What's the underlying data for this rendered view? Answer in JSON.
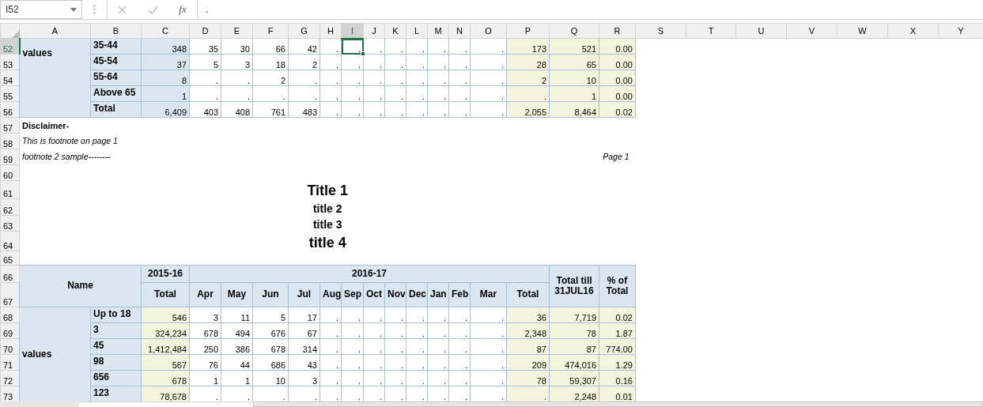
{
  "name_box": {
    "text": "I52"
  },
  "formula_bar": {
    "function_label": "fx",
    "value": "."
  },
  "columns": [
    "A",
    "B",
    "C",
    "D",
    "E",
    "F",
    "G",
    "H",
    "I",
    "J",
    "K",
    "L",
    "M",
    "N",
    "O",
    "P",
    "Q",
    "R",
    "S",
    "T",
    "U",
    "V",
    "W",
    "X",
    "Y"
  ],
  "rows": [
    {
      "number": "52",
      "cells": [
        {
          "text": "values",
          "kind": "group",
          "selected": false
        },
        {
          "text": "35-44",
          "kind": "label",
          "selected": false
        },
        {
          "text": "348",
          "kind": "bnum",
          "selected": false
        },
        {
          "text": "35",
          "kind": "num",
          "selected": false
        },
        {
          "text": "30",
          "kind": "num",
          "selected": false
        },
        {
          "text": "66",
          "kind": "num",
          "selected": false
        },
        {
          "text": "42",
          "kind": "num",
          "selected": false
        },
        {
          "text": ".",
          "kind": "num",
          "selected": false
        },
        {
          "text": ".",
          "kind": "num",
          "selected": true
        },
        {
          "text": ".",
          "kind": "num",
          "selected": false
        },
        {
          "text": ".",
          "kind": "num",
          "selected": false
        },
        {
          "text": ".",
          "kind": "num",
          "selected": false
        },
        {
          "text": ".",
          "kind": "num",
          "selected": false
        },
        {
          "text": ".",
          "kind": "num",
          "selected": false
        },
        {
          "text": ".",
          "kind": "num",
          "selected": false
        },
        {
          "text": "173",
          "kind": "sum",
          "selected": false
        },
        {
          "text": "521",
          "kind": "sum",
          "selected": false
        },
        {
          "text": "0.00",
          "kind": "sum",
          "selected": false
        }
      ]
    },
    {
      "number": "53",
      "cells": [
        {
          "text": "45-54",
          "kind": "label",
          "selected": false
        },
        {
          "text": "37",
          "kind": "bnum",
          "selected": false
        },
        {
          "text": "5",
          "kind": "num",
          "selected": false
        },
        {
          "text": "3",
          "kind": "num",
          "selected": false
        },
        {
          "text": "18",
          "kind": "num",
          "selected": false
        },
        {
          "text": "2",
          "kind": "num",
          "selected": false
        },
        {
          "text": ".",
          "kind": "num",
          "selected": false
        },
        {
          "text": ".",
          "kind": "num",
          "selected": false
        },
        {
          "text": ".",
          "kind": "num",
          "selected": false
        },
        {
          "text": ".",
          "kind": "num",
          "selected": false
        },
        {
          "text": ".",
          "kind": "num",
          "selected": false
        },
        {
          "text": ".",
          "kind": "num",
          "selected": false
        },
        {
          "text": ".",
          "kind": "num",
          "selected": false
        },
        {
          "text": ".",
          "kind": "num",
          "selected": false
        },
        {
          "text": "28",
          "kind": "sum",
          "selected": false
        },
        {
          "text": "65",
          "kind": "sum",
          "selected": false
        },
        {
          "text": "0.00",
          "kind": "sum",
          "selected": false
        }
      ]
    },
    {
      "number": "54",
      "cells": [
        {
          "text": "55-64",
          "kind": "label",
          "selected": false
        },
        {
          "text": "8",
          "kind": "bnum",
          "selected": false
        },
        {
          "text": ".",
          "kind": "num",
          "selected": false
        },
        {
          "text": ".",
          "kind": "num",
          "selected": false
        },
        {
          "text": "2",
          "kind": "num",
          "selected": false
        },
        {
          "text": ".",
          "kind": "num",
          "selected": false
        },
        {
          "text": ".",
          "kind": "num",
          "selected": false
        },
        {
          "text": ".",
          "kind": "num",
          "selected": false
        },
        {
          "text": ".",
          "kind": "num",
          "selected": false
        },
        {
          "text": ".",
          "kind": "num",
          "selected": false
        },
        {
          "text": ".",
          "kind": "num",
          "selected": false
        },
        {
          "text": ".",
          "kind": "num",
          "selected": false
        },
        {
          "text": ".",
          "kind": "num",
          "selected": false
        },
        {
          "text": ".",
          "kind": "num",
          "selected": false
        },
        {
          "text": "2",
          "kind": "sum",
          "selected": false
        },
        {
          "text": "10",
          "kind": "sum",
          "selected": false
        },
        {
          "text": "0.00",
          "kind": "sum",
          "selected": false
        }
      ]
    },
    {
      "number": "55",
      "cells": [
        {
          "text": "Above 65",
          "kind": "label",
          "selected": false
        },
        {
          "text": "1",
          "kind": "bnum",
          "selected": false
        },
        {
          "text": ".",
          "kind": "num",
          "selected": false
        },
        {
          "text": ".",
          "kind": "num",
          "selected": false
        },
        {
          "text": ".",
          "kind": "num",
          "selected": false
        },
        {
          "text": ".",
          "kind": "num",
          "selected": false
        },
        {
          "text": ".",
          "kind": "num",
          "selected": false
        },
        {
          "text": ".",
          "kind": "num",
          "selected": false
        },
        {
          "text": ".",
          "kind": "num",
          "selected": false
        },
        {
          "text": ".",
          "kind": "num",
          "selected": false
        },
        {
          "text": ".",
          "kind": "num",
          "selected": false
        },
        {
          "text": ".",
          "kind": "num",
          "selected": false
        },
        {
          "text": ".",
          "kind": "num",
          "selected": false
        },
        {
          "text": ".",
          "kind": "num",
          "selected": false
        },
        {
          "text": ".",
          "kind": "sum",
          "selected": false
        },
        {
          "text": "1",
          "kind": "sum",
          "selected": false
        },
        {
          "text": "0.00",
          "kind": "sum",
          "selected": false
        }
      ]
    },
    {
      "number": "56",
      "cells": [
        {
          "text": "Total",
          "kind": "label",
          "selected": false
        },
        {
          "text": "6,409",
          "kind": "bnum",
          "selected": false
        },
        {
          "text": "403",
          "kind": "num",
          "selected": false
        },
        {
          "text": "408",
          "kind": "num",
          "selected": false
        },
        {
          "text": "761",
          "kind": "num",
          "selected": false
        },
        {
          "text": "483",
          "kind": "num",
          "selected": false
        },
        {
          "text": ".",
          "kind": "num",
          "selected": false
        },
        {
          "text": ".",
          "kind": "num",
          "selected": false
        },
        {
          "text": ".",
          "kind": "num",
          "selected": false
        },
        {
          "text": ".",
          "kind": "num",
          "selected": false
        },
        {
          "text": ".",
          "kind": "num",
          "selected": false
        },
        {
          "text": ".",
          "kind": "num",
          "selected": false
        },
        {
          "text": ".",
          "kind": "num",
          "selected": false
        },
        {
          "text": ".",
          "kind": "num",
          "selected": false
        },
        {
          "text": "2,055",
          "kind": "sum",
          "selected": false
        },
        {
          "text": "8,464",
          "kind": "sum",
          "selected": false
        },
        {
          "text": "0.02",
          "kind": "sum",
          "selected": false
        }
      ]
    },
    {
      "number": "57",
      "cells": [
        {
          "text": "Disclaimer-",
          "kind": "note-bold",
          "selected": false
        }
      ]
    },
    {
      "number": "58",
      "cells": [
        {
          "text": "This is footnote on page 1",
          "kind": "note",
          "selected": false
        }
      ]
    },
    {
      "number": "59",
      "cells": [
        {
          "text": "footnote 2 sample--------",
          "kind": "note",
          "selected": false
        },
        null,
        null,
        null,
        null,
        null,
        null,
        null,
        null,
        null,
        null,
        null,
        null,
        null,
        null,
        null,
        null,
        {
          "text": "Page 1",
          "kind": "note-right",
          "selected": false
        }
      ]
    },
    {
      "number": "60",
      "cells": []
    },
    {
      "number": "61",
      "cells": [
        {
          "text": "Title 1",
          "kind": "title-lg",
          "selected": false
        }
      ]
    },
    {
      "number": "62",
      "cells": [
        {
          "text": "title 2",
          "kind": "title-sm",
          "selected": false
        }
      ]
    },
    {
      "number": "63",
      "cells": [
        {
          "text": "title 3",
          "kind": "title-sm",
          "selected": false
        }
      ]
    },
    {
      "number": "64",
      "cells": [
        {
          "text": "title 4",
          "kind": "title-lg",
          "selected": false
        }
      ]
    },
    {
      "number": "65",
      "cells": []
    },
    {
      "number": "66",
      "cells": [
        {
          "text": "Name",
          "kind": "head",
          "selected": false
        },
        {
          "text": "2015-16",
          "kind": "head",
          "selected": false
        },
        {
          "text": "2016-17",
          "kind": "head",
          "selected": false
        },
        {
          "text": "Total till 31JUL16",
          "kind": "head",
          "selected": false
        },
        {
          "text": "% of Total",
          "kind": "head",
          "selected": false
        }
      ]
    },
    {
      "number": "67",
      "cells": [
        {
          "text": "Total",
          "kind": "head",
          "selected": false
        },
        {
          "text": "Apr",
          "kind": "head",
          "selected": false
        },
        {
          "text": "May",
          "kind": "head",
          "selected": false
        },
        {
          "text": "Jun",
          "kind": "head",
          "selected": false
        },
        {
          "text": "Jul",
          "kind": "head",
          "selected": false
        },
        {
          "text": "Aug",
          "kind": "head",
          "selected": false
        },
        {
          "text": "Sep",
          "kind": "head",
          "selected": false
        },
        {
          "text": "Oct",
          "kind": "head",
          "selected": false
        },
        {
          "text": "Nov",
          "kind": "head",
          "selected": false
        },
        {
          "text": "Dec",
          "kind": "head",
          "selected": false
        },
        {
          "text": "Jan",
          "kind": "head",
          "selected": false
        },
        {
          "text": "Feb",
          "kind": "head",
          "selected": false
        },
        {
          "text": "Mar",
          "kind": "head",
          "selected": false
        },
        {
          "text": "Total",
          "kind": "head",
          "selected": false
        }
      ]
    },
    {
      "number": "68",
      "cells": [
        {
          "text": "values",
          "kind": "group",
          "selected": false
        },
        {
          "text": "Up to 18",
          "kind": "label",
          "selected": false
        },
        {
          "text": "546",
          "kind": "sum",
          "selected": false
        },
        {
          "text": "3",
          "kind": "num",
          "selected": false
        },
        {
          "text": "11",
          "kind": "num",
          "selected": false
        },
        {
          "text": "5",
          "kind": "num",
          "selected": false
        },
        {
          "text": "17",
          "kind": "num",
          "selected": false
        },
        {
          "text": ".",
          "kind": "num",
          "selected": false
        },
        {
          "text": ".",
          "kind": "num",
          "selected": false
        },
        {
          "text": ".",
          "kind": "num",
          "selected": false
        },
        {
          "text": ".",
          "kind": "num",
          "selected": false
        },
        {
          "text": ".",
          "kind": "num",
          "selected": false
        },
        {
          "text": ".",
          "kind": "num",
          "selected": false
        },
        {
          "text": ".",
          "kind": "num",
          "selected": false
        },
        {
          "text": ".",
          "kind": "num",
          "selected": false
        },
        {
          "text": "36",
          "kind": "sum",
          "selected": false
        },
        {
          "text": "7,719",
          "kind": "sum",
          "selected": false
        },
        {
          "text": "0.02",
          "kind": "sum",
          "selected": false
        }
      ]
    },
    {
      "number": "69",
      "cells": [
        {
          "text": "3",
          "kind": "label",
          "selected": false
        },
        {
          "text": "324,234",
          "kind": "sum",
          "selected": false
        },
        {
          "text": "678",
          "kind": "num",
          "selected": false
        },
        {
          "text": "494",
          "kind": "num",
          "selected": false
        },
        {
          "text": "676",
          "kind": "num",
          "selected": false
        },
        {
          "text": "67",
          "kind": "num",
          "selected": false
        },
        {
          "text": ".",
          "kind": "num",
          "selected": false
        },
        {
          "text": ".",
          "kind": "num",
          "selected": false
        },
        {
          "text": ".",
          "kind": "num",
          "selected": false
        },
        {
          "text": ".",
          "kind": "num",
          "selected": false
        },
        {
          "text": ".",
          "kind": "num",
          "selected": false
        },
        {
          "text": ".",
          "kind": "num",
          "selected": false
        },
        {
          "text": ".",
          "kind": "num",
          "selected": false
        },
        {
          "text": ".",
          "kind": "num",
          "selected": false
        },
        {
          "text": "2,348",
          "kind": "sum",
          "selected": false
        },
        {
          "text": "78",
          "kind": "sum",
          "selected": false
        },
        {
          "text": "1.87",
          "kind": "sum",
          "selected": false
        }
      ]
    },
    {
      "number": "70",
      "cells": [
        {
          "text": "45",
          "kind": "label",
          "selected": false
        },
        {
          "text": "1,412,484",
          "kind": "sum",
          "selected": false
        },
        {
          "text": "250",
          "kind": "num",
          "selected": false
        },
        {
          "text": "386",
          "kind": "num",
          "selected": false
        },
        {
          "text": "678",
          "kind": "num",
          "selected": false
        },
        {
          "text": "314",
          "kind": "num",
          "selected": false
        },
        {
          "text": ".",
          "kind": "num",
          "selected": false
        },
        {
          "text": ".",
          "kind": "num",
          "selected": false
        },
        {
          "text": ".",
          "kind": "num",
          "selected": false
        },
        {
          "text": ".",
          "kind": "num",
          "selected": false
        },
        {
          "text": ".",
          "kind": "num",
          "selected": false
        },
        {
          "text": ".",
          "kind": "num",
          "selected": false
        },
        {
          "text": ".",
          "kind": "num",
          "selected": false
        },
        {
          "text": ".",
          "kind": "num",
          "selected": false
        },
        {
          "text": "87",
          "kind": "sum",
          "selected": false
        },
        {
          "text": "87",
          "kind": "sum",
          "selected": false
        },
        {
          "text": "774.00",
          "kind": "sum",
          "selected": false
        }
      ]
    },
    {
      "number": "71",
      "cells": [
        {
          "text": "98",
          "kind": "label",
          "selected": false
        },
        {
          "text": "567",
          "kind": "sum",
          "selected": false
        },
        {
          "text": "76",
          "kind": "num",
          "selected": false
        },
        {
          "text": "44",
          "kind": "num",
          "selected": false
        },
        {
          "text": "686",
          "kind": "num",
          "selected": false
        },
        {
          "text": "43",
          "kind": "num",
          "selected": false
        },
        {
          "text": ".",
          "kind": "num",
          "selected": false
        },
        {
          "text": ".",
          "kind": "num",
          "selected": false
        },
        {
          "text": ".",
          "kind": "num",
          "selected": false
        },
        {
          "text": ".",
          "kind": "num",
          "selected": false
        },
        {
          "text": ".",
          "kind": "num",
          "selected": false
        },
        {
          "text": ".",
          "kind": "num",
          "selected": false
        },
        {
          "text": ".",
          "kind": "num",
          "selected": false
        },
        {
          "text": ".",
          "kind": "num",
          "selected": false
        },
        {
          "text": "209",
          "kind": "sum",
          "selected": false
        },
        {
          "text": "474,016",
          "kind": "sum",
          "selected": false
        },
        {
          "text": "1.29",
          "kind": "sum",
          "selected": false
        }
      ]
    },
    {
      "number": "72",
      "cells": [
        {
          "text": "656",
          "kind": "label",
          "selected": false
        },
        {
          "text": "678",
          "kind": "sum",
          "selected": false
        },
        {
          "text": "1",
          "kind": "num",
          "selected": false
        },
        {
          "text": "1",
          "kind": "num",
          "selected": false
        },
        {
          "text": "10",
          "kind": "num",
          "selected": false
        },
        {
          "text": "3",
          "kind": "num",
          "selected": false
        },
        {
          "text": ".",
          "kind": "num",
          "selected": false
        },
        {
          "text": ".",
          "kind": "num",
          "selected": false
        },
        {
          "text": ".",
          "kind": "num",
          "selected": false
        },
        {
          "text": ".",
          "kind": "num",
          "selected": false
        },
        {
          "text": ".",
          "kind": "num",
          "selected": false
        },
        {
          "text": ".",
          "kind": "num",
          "selected": false
        },
        {
          "text": ".",
          "kind": "num",
          "selected": false
        },
        {
          "text": ".",
          "kind": "num",
          "selected": false
        },
        {
          "text": "78",
          "kind": "sum",
          "selected": false
        },
        {
          "text": "59,307",
          "kind": "sum",
          "selected": false
        },
        {
          "text": "0.16",
          "kind": "sum",
          "selected": false
        }
      ]
    },
    {
      "number": "73",
      "cells": [
        {
          "text": "123",
          "kind": "label",
          "selected": false
        },
        {
          "text": "78,678",
          "kind": "sum",
          "selected": false
        },
        {
          "text": ".",
          "kind": "num",
          "selected": false
        },
        {
          "text": ".",
          "kind": "num",
          "selected": false
        },
        {
          "text": ".",
          "kind": "num",
          "selected": false
        },
        {
          "text": ".",
          "kind": "num",
          "selected": false
        },
        {
          "text": ".",
          "kind": "num",
          "selected": false
        },
        {
          "text": ".",
          "kind": "num",
          "selected": false
        },
        {
          "text": ".",
          "kind": "num",
          "selected": false
        },
        {
          "text": ".",
          "kind": "num",
          "selected": false
        },
        {
          "text": ".",
          "kind": "num",
          "selected": false
        },
        {
          "text": ".",
          "kind": "num",
          "selected": false
        },
        {
          "text": ".",
          "kind": "num",
          "selected": false
        },
        {
          "text": ".",
          "kind": "num",
          "selected": false
        },
        {
          "text": ".",
          "kind": "sum",
          "selected": false
        },
        {
          "text": "2,248",
          "kind": "sum",
          "selected": false
        },
        {
          "text": "0.01",
          "kind": "sum",
          "selected": false
        }
      ]
    }
  ]
}
